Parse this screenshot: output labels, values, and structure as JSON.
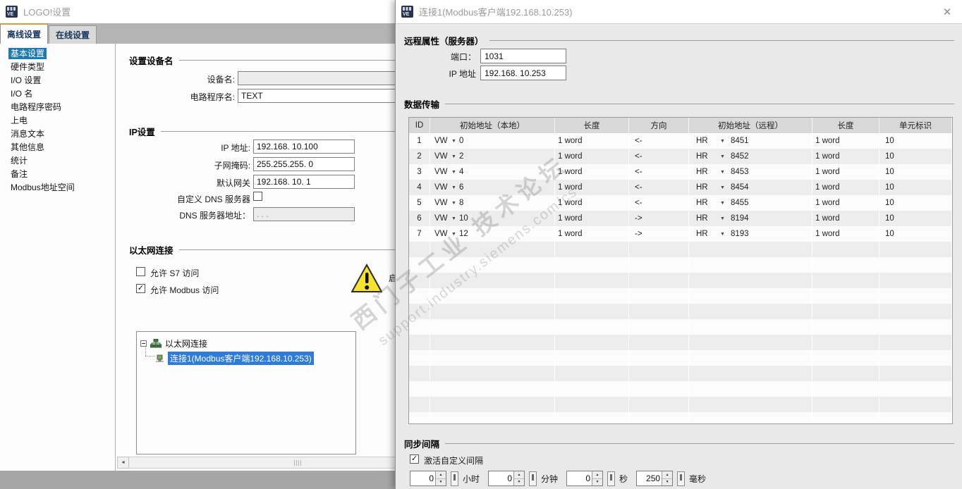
{
  "icons": {
    "dropdown_glyph": "▼",
    "close_glyph": "✕",
    "check_glyph": "✓",
    "scroll_left_glyph": "◄",
    "spin_up_glyph": "▲",
    "spin_down_glyph": "▼",
    "warning_glyph": "!"
  },
  "left_window": {
    "title": "LOGO!设置",
    "tabs": [
      {
        "label": "离线设置",
        "active": true
      },
      {
        "label": "在线设置",
        "active": false
      }
    ],
    "sidebar": {
      "items": [
        {
          "label": "基本设置",
          "selected": true
        },
        {
          "label": "硬件类型",
          "selected": false
        },
        {
          "label": "I/O 设置",
          "selected": false
        },
        {
          "label": "I/O 名",
          "selected": false
        },
        {
          "label": "电路程序密码",
          "selected": false
        },
        {
          "label": "上电",
          "selected": false
        },
        {
          "label": "消息文本",
          "selected": false
        },
        {
          "label": "其他信息",
          "selected": false
        },
        {
          "label": "统计",
          "selected": false
        },
        {
          "label": "备注",
          "selected": false
        },
        {
          "label": "Modbus地址空间",
          "selected": false
        }
      ]
    },
    "name_group": {
      "title": "设置设备名",
      "device_name_label": "设备名:",
      "device_name_value": "",
      "program_name_label": "电路程序名:",
      "program_name_value": "TEXT"
    },
    "ip_group": {
      "title": "IP设置",
      "ip_label": "IP 地址:",
      "ip_value": "192.168. 10.100",
      "mask_label": "子网掩码:",
      "mask_value": "255.255.255.  0",
      "gateway_label": "默认网关",
      "gateway_value": "192.168. 10.  1",
      "dns_checkbox_label": "自定义 DNS 服务器",
      "dns_checked": false,
      "dns_addr_label": "DNS 服务器地址：",
      "dns_addr_value": "  .    .    ."
    },
    "eth_group": {
      "title": "以太网连接",
      "s7_label": "允许 S7 访问",
      "s7_checked": false,
      "modbus_label": "允许 Modbus 访问",
      "modbus_checked": true,
      "clipped_text": "启"
    },
    "tree": {
      "root_label": "以太网连接",
      "child_label": "连接1(Modbus客户端192.168.10.253)"
    }
  },
  "right_window": {
    "title": "连接1(Modbus客户端192.168.10.253)",
    "remote_group": {
      "title": "远程属性（服务器）",
      "port_label": "端口：",
      "port_value": "1031",
      "ip_label": "IP 地址",
      "ip_value": "192.168. 10.253"
    },
    "transfer_group": {
      "title": "数据传输",
      "columns": [
        "ID",
        "初始地址（本地）",
        "长度",
        "方向",
        "初始地址（远程）",
        "长度",
        "单元标识"
      ],
      "rows": [
        {
          "id": "1",
          "local_type": "VW",
          "local_addr": "0",
          "len": "1 word",
          "dir": "<-",
          "remote_type": "HR",
          "remote_addr": "8451",
          "rlen": "1 word",
          "unit": "10"
        },
        {
          "id": "2",
          "local_type": "VW",
          "local_addr": "2",
          "len": "1 word",
          "dir": "<-",
          "remote_type": "HR",
          "remote_addr": "8452",
          "rlen": "1 word",
          "unit": "10"
        },
        {
          "id": "3",
          "local_type": "VW",
          "local_addr": "4",
          "len": "1 word",
          "dir": "<-",
          "remote_type": "HR",
          "remote_addr": "8453",
          "rlen": "1 word",
          "unit": "10"
        },
        {
          "id": "4",
          "local_type": "VW",
          "local_addr": "6",
          "len": "1 word",
          "dir": "<-",
          "remote_type": "HR",
          "remote_addr": "8454",
          "rlen": "1 word",
          "unit": "10"
        },
        {
          "id": "5",
          "local_type": "VW",
          "local_addr": "8",
          "len": "1 word",
          "dir": "<-",
          "remote_type": "HR",
          "remote_addr": "8455",
          "rlen": "1 word",
          "unit": "10"
        },
        {
          "id": "6",
          "local_type": "VW",
          "local_addr": "10",
          "len": "1 word",
          "dir": "->",
          "remote_type": "HR",
          "remote_addr": "8194",
          "rlen": "1 word",
          "unit": "10"
        },
        {
          "id": "7",
          "local_type": "VW",
          "local_addr": "12",
          "len": "1 word",
          "dir": "->",
          "remote_type": "HR",
          "remote_addr": "8193",
          "rlen": "1 word",
          "unit": "10"
        }
      ],
      "empty_rows": 12
    },
    "sync_group": {
      "title": "同步间隔",
      "checkbox_label": "激活自定义间隔",
      "checkbox_checked": true,
      "spinners": [
        {
          "value": "0",
          "unit": "小时"
        },
        {
          "value": "0",
          "unit": "分钟"
        },
        {
          "value": "0",
          "unit": "秒"
        },
        {
          "value": "250",
          "unit": "毫秒"
        }
      ]
    }
  },
  "watermark": {
    "line1": "西门子工业  技术论坛",
    "line2": "support.industry.siemens.com/cs"
  },
  "colors": {
    "accent_orange": "#e39b33",
    "sidebar_selected": "#1f78b0",
    "tree_selected": "#2e7bd8",
    "tab_text": "#17375e",
    "desktop": "#a6a6a6"
  }
}
